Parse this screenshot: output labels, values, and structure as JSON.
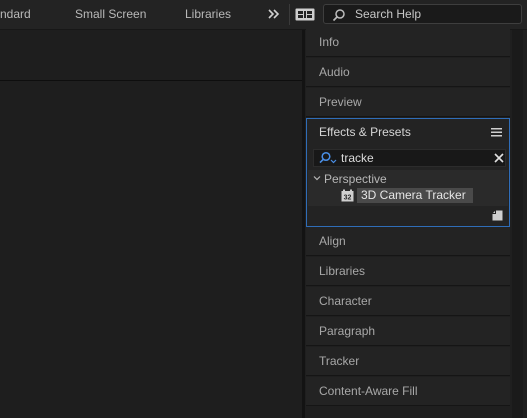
{
  "workspace_bar": {
    "items": [
      "ndard",
      "Small Screen",
      "Libraries"
    ],
    "more_icon": "double-chevron-right-icon",
    "workspace_icon": "workspace-switcher-icon",
    "search_help": {
      "icon": "search-icon",
      "placeholder": "Search Help"
    }
  },
  "panels": {
    "above": [
      "Info",
      "Audio",
      "Preview"
    ],
    "effects": {
      "title": "Effects & Presets",
      "menu_icon": "hamburger-menu-icon",
      "search_value": "tracke",
      "search_icon": "search-filter-icon",
      "clear_icon": "close-icon",
      "category": "Perspective",
      "category_icon": "chevron-down-icon",
      "effect_badge": "32",
      "effect_label": "3D Camera Tracker",
      "new_bin_icon": "new-bin-icon"
    },
    "below": [
      "Align",
      "Libraries",
      "Character",
      "Paragraph",
      "Tracker",
      "Content-Aware Fill"
    ]
  },
  "colors": {
    "accent_focus": "#2f6db8",
    "background": "#1d1d1d"
  }
}
